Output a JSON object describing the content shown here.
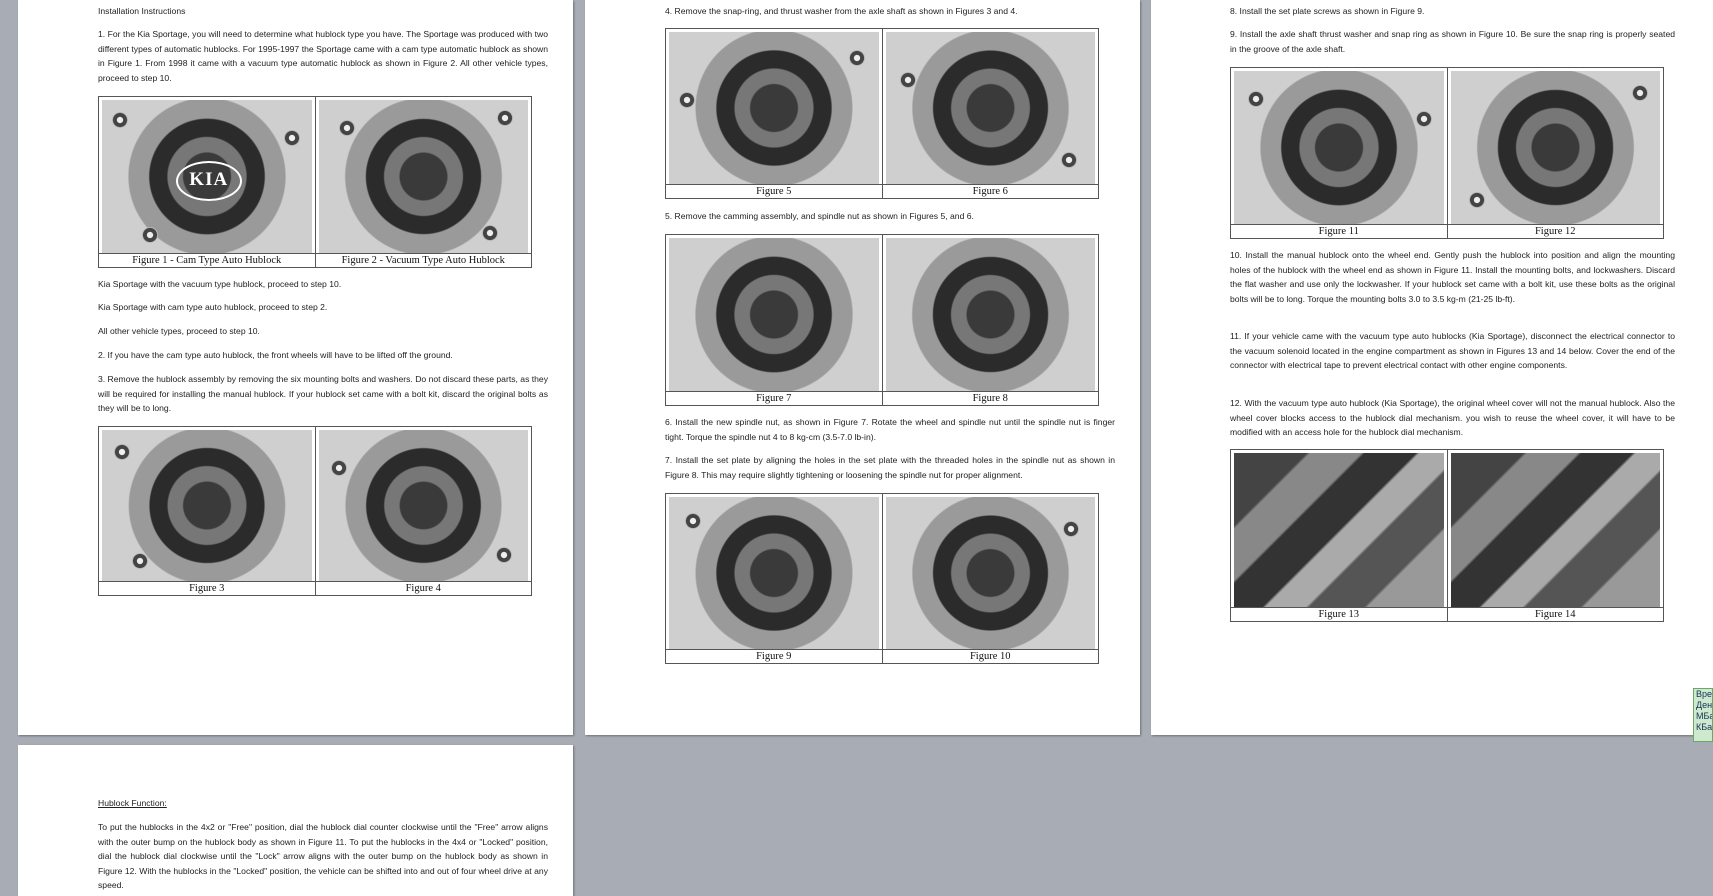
{
  "page1": {
    "heading": "Installation  Instructions",
    "step1": "1.   For the Kia Sportage, you will need to determine what hublock type you have. The Sportage was produced with two different types of automatic hublocks. For 1995-1997 the Sportage came with a cam type automatic hublock as shown in Figure 1. From 1998 it came with a vacuum type automatic hublock as shown in Figure 2. All other vehicle types, proceed to step 10.",
    "fig12": {
      "cap1": "Figure 1 - Cam Type Auto Hublock",
      "cap2": "Figure 2 - Vacuum Type Auto Hublock",
      "logo": "KIA"
    },
    "opt_vacuum": "Kia Sportage with the vacuum type hublock, proceed to step 10.",
    "opt_cam": "Kia Sportage with cam type auto hublock, proceed to step 2.",
    "opt_other": "All other vehicle types, proceed to step 10.",
    "step2": "2.   If you have the cam type auto hublock, the front wheels will have to be lifted off the ground.",
    "step3": "3.   Remove the hublock assembly by removing the six mounting  bolts and washers. Do not discard these parts, as they will be required for installing  the manual hublock.  If your hublock set came with a bolt kit, discard the original  bolts  as they will be to long.",
    "fig34": {
      "cap1": "Figure 3",
      "cap2": "Figure 4"
    }
  },
  "page2": {
    "step4": "4.   Remove the snap-ring, and thrust washer from the axle shaft as shown in Figures 3 and 4.",
    "fig56": {
      "cap1": "Figure 5",
      "cap2": "Figure 6"
    },
    "step5": "5.   Remove the camming assembly, and spindle  nut  as shown  in Figures 5, and 6.",
    "fig78": {
      "cap1": "Figure 7",
      "cap2": "Figure 8"
    },
    "step6": "6.   Install the new spindle  nut,  as shown in Figure 7. Rotate  the wheel and spindle nut until  the spindle nut is finger tight.  Torque the spindle  nut 4 to 8 kg-cm (3.5-7.0 lb-in).",
    "step7": "7.   Install the set plate by aligning  the holes in the set plate with the threaded holes in the spindle nut as shown  in Figure 8. This may require slightly tightening  or loosening  the spindle  nut for proper alignment.",
    "fig910": {
      "cap1": "Figure 9",
      "cap2": "Figure 10"
    }
  },
  "page3": {
    "step8": "8.   Install the set plate  screws as shown in Figure 9.",
    "step9": "9.   Install the axle shaft thrust  washer and snap ring as shown in Figure 10. Be sure the  snap ring is properly seated in the groove of the axle shaft.",
    "fig1112": {
      "cap1": "Figure 11",
      "cap2": "Figure 12"
    },
    "step10": "10.   Install  the manual hublock onto the wheel end. Gently  push the hublock into position  and align the mounting  holes of the hublock  with the wheel end as shown in Figure 11. Install the mounting  bolts,  and lockwashers. Discard the flat washer and use only the lockwasher.  If your hublock set came with a bolt kit, use these bolts as the original bolts  will be to long. Torque the  mounting  bolts 3.0 to 3.5 kg-m (21-25 lb-ft).",
    "step11": "11.   If your vehicle  came with the vacuum type auto hublocks (Kia Sportage), disconnect  the electrical connector  to the vacuum solenoid  located  in the engine compartment  as shown in Figures 13 and 14 below.  Cover the end of the connector  with electrical tape to prevent electrical contact with other engine components.",
    "step12": "12.   With the vacuum type auto hublock (Kia Sportage), the original  wheel cover will not the manual hublock. Also the wheel cover blocks access to the hublock  dial mechanism.  you wish to reuse the wheel cover, it will have to be modified with an access hole for the hublock dial mechanism.",
    "fig1314": {
      "cap1": "Figure 13",
      "cap2": "Figure 14"
    }
  },
  "page4": {
    "heading": "Hublock  Function:",
    "body": "To put the hublocks  in the 4x2 or \"Free\" position,  dial the hublock dial counter clockwise until the \"Free\" arrow aligns with the outer bump on the hublock body as shown in Figure 11. To put the hublocks in the 4x4 or \"Locked\" position,  dial the hublock dial clockwise until the \"Lock\" arrow aligns with the outer bump on the hublock body as shown in Figure 12. With the hublocks  in the \"Locked\" position,  the vehicle can be shifted into and out of four wheel drive at any speed."
  },
  "side_note": "Вре Ден МБа КБа"
}
